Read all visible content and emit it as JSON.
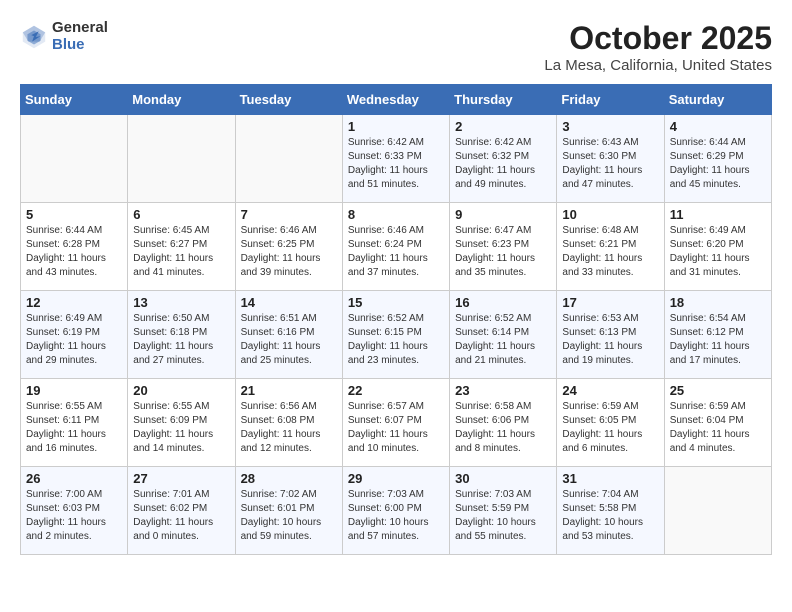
{
  "logo": {
    "general": "General",
    "blue": "Blue"
  },
  "title": "October 2025",
  "location": "La Mesa, California, United States",
  "days_of_week": [
    "Sunday",
    "Monday",
    "Tuesday",
    "Wednesday",
    "Thursday",
    "Friday",
    "Saturday"
  ],
  "weeks": [
    [
      {
        "day": "",
        "sunrise": "",
        "sunset": "",
        "daylight": ""
      },
      {
        "day": "",
        "sunrise": "",
        "sunset": "",
        "daylight": ""
      },
      {
        "day": "",
        "sunrise": "",
        "sunset": "",
        "daylight": ""
      },
      {
        "day": "1",
        "sunrise": "Sunrise: 6:42 AM",
        "sunset": "Sunset: 6:33 PM",
        "daylight": "Daylight: 11 hours and 51 minutes."
      },
      {
        "day": "2",
        "sunrise": "Sunrise: 6:42 AM",
        "sunset": "Sunset: 6:32 PM",
        "daylight": "Daylight: 11 hours and 49 minutes."
      },
      {
        "day": "3",
        "sunrise": "Sunrise: 6:43 AM",
        "sunset": "Sunset: 6:30 PM",
        "daylight": "Daylight: 11 hours and 47 minutes."
      },
      {
        "day": "4",
        "sunrise": "Sunrise: 6:44 AM",
        "sunset": "Sunset: 6:29 PM",
        "daylight": "Daylight: 11 hours and 45 minutes."
      }
    ],
    [
      {
        "day": "5",
        "sunrise": "Sunrise: 6:44 AM",
        "sunset": "Sunset: 6:28 PM",
        "daylight": "Daylight: 11 hours and 43 minutes."
      },
      {
        "day": "6",
        "sunrise": "Sunrise: 6:45 AM",
        "sunset": "Sunset: 6:27 PM",
        "daylight": "Daylight: 11 hours and 41 minutes."
      },
      {
        "day": "7",
        "sunrise": "Sunrise: 6:46 AM",
        "sunset": "Sunset: 6:25 PM",
        "daylight": "Daylight: 11 hours and 39 minutes."
      },
      {
        "day": "8",
        "sunrise": "Sunrise: 6:46 AM",
        "sunset": "Sunset: 6:24 PM",
        "daylight": "Daylight: 11 hours and 37 minutes."
      },
      {
        "day": "9",
        "sunrise": "Sunrise: 6:47 AM",
        "sunset": "Sunset: 6:23 PM",
        "daylight": "Daylight: 11 hours and 35 minutes."
      },
      {
        "day": "10",
        "sunrise": "Sunrise: 6:48 AM",
        "sunset": "Sunset: 6:21 PM",
        "daylight": "Daylight: 11 hours and 33 minutes."
      },
      {
        "day": "11",
        "sunrise": "Sunrise: 6:49 AM",
        "sunset": "Sunset: 6:20 PM",
        "daylight": "Daylight: 11 hours and 31 minutes."
      }
    ],
    [
      {
        "day": "12",
        "sunrise": "Sunrise: 6:49 AM",
        "sunset": "Sunset: 6:19 PM",
        "daylight": "Daylight: 11 hours and 29 minutes."
      },
      {
        "day": "13",
        "sunrise": "Sunrise: 6:50 AM",
        "sunset": "Sunset: 6:18 PM",
        "daylight": "Daylight: 11 hours and 27 minutes."
      },
      {
        "day": "14",
        "sunrise": "Sunrise: 6:51 AM",
        "sunset": "Sunset: 6:16 PM",
        "daylight": "Daylight: 11 hours and 25 minutes."
      },
      {
        "day": "15",
        "sunrise": "Sunrise: 6:52 AM",
        "sunset": "Sunset: 6:15 PM",
        "daylight": "Daylight: 11 hours and 23 minutes."
      },
      {
        "day": "16",
        "sunrise": "Sunrise: 6:52 AM",
        "sunset": "Sunset: 6:14 PM",
        "daylight": "Daylight: 11 hours and 21 minutes."
      },
      {
        "day": "17",
        "sunrise": "Sunrise: 6:53 AM",
        "sunset": "Sunset: 6:13 PM",
        "daylight": "Daylight: 11 hours and 19 minutes."
      },
      {
        "day": "18",
        "sunrise": "Sunrise: 6:54 AM",
        "sunset": "Sunset: 6:12 PM",
        "daylight": "Daylight: 11 hours and 17 minutes."
      }
    ],
    [
      {
        "day": "19",
        "sunrise": "Sunrise: 6:55 AM",
        "sunset": "Sunset: 6:11 PM",
        "daylight": "Daylight: 11 hours and 16 minutes."
      },
      {
        "day": "20",
        "sunrise": "Sunrise: 6:55 AM",
        "sunset": "Sunset: 6:09 PM",
        "daylight": "Daylight: 11 hours and 14 minutes."
      },
      {
        "day": "21",
        "sunrise": "Sunrise: 6:56 AM",
        "sunset": "Sunset: 6:08 PM",
        "daylight": "Daylight: 11 hours and 12 minutes."
      },
      {
        "day": "22",
        "sunrise": "Sunrise: 6:57 AM",
        "sunset": "Sunset: 6:07 PM",
        "daylight": "Daylight: 11 hours and 10 minutes."
      },
      {
        "day": "23",
        "sunrise": "Sunrise: 6:58 AM",
        "sunset": "Sunset: 6:06 PM",
        "daylight": "Daylight: 11 hours and 8 minutes."
      },
      {
        "day": "24",
        "sunrise": "Sunrise: 6:59 AM",
        "sunset": "Sunset: 6:05 PM",
        "daylight": "Daylight: 11 hours and 6 minutes."
      },
      {
        "day": "25",
        "sunrise": "Sunrise: 6:59 AM",
        "sunset": "Sunset: 6:04 PM",
        "daylight": "Daylight: 11 hours and 4 minutes."
      }
    ],
    [
      {
        "day": "26",
        "sunrise": "Sunrise: 7:00 AM",
        "sunset": "Sunset: 6:03 PM",
        "daylight": "Daylight: 11 hours and 2 minutes."
      },
      {
        "day": "27",
        "sunrise": "Sunrise: 7:01 AM",
        "sunset": "Sunset: 6:02 PM",
        "daylight": "Daylight: 11 hours and 0 minutes."
      },
      {
        "day": "28",
        "sunrise": "Sunrise: 7:02 AM",
        "sunset": "Sunset: 6:01 PM",
        "daylight": "Daylight: 10 hours and 59 minutes."
      },
      {
        "day": "29",
        "sunrise": "Sunrise: 7:03 AM",
        "sunset": "Sunset: 6:00 PM",
        "daylight": "Daylight: 10 hours and 57 minutes."
      },
      {
        "day": "30",
        "sunrise": "Sunrise: 7:03 AM",
        "sunset": "Sunset: 5:59 PM",
        "daylight": "Daylight: 10 hours and 55 minutes."
      },
      {
        "day": "31",
        "sunrise": "Sunrise: 7:04 AM",
        "sunset": "Sunset: 5:58 PM",
        "daylight": "Daylight: 10 hours and 53 minutes."
      },
      {
        "day": "",
        "sunrise": "",
        "sunset": "",
        "daylight": ""
      }
    ]
  ]
}
